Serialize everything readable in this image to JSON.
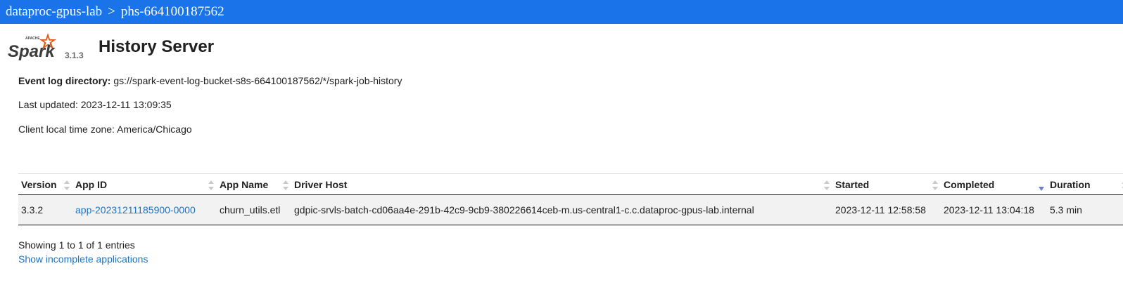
{
  "breadcrumb": {
    "project": "dataproc-gpus-lab",
    "separator": ">",
    "server": "phs-664100187562"
  },
  "header": {
    "logo_small": "APACHE",
    "logo_text": "Spark",
    "spark_version": "3.1.3",
    "title": "History Server"
  },
  "info": {
    "event_log_label": "Event log directory:",
    "event_log_value": "gs://spark-event-log-bucket-s8s-664100187562/*/spark-job-history",
    "last_updated": "Last updated: 2023-12-11 13:09:35",
    "timezone": "Client local time zone: America/Chicago"
  },
  "table": {
    "headers": [
      "Version",
      "App ID",
      "App Name",
      "Driver Host",
      "Started",
      "Completed",
      "Duration"
    ],
    "sorted_column": "Completed",
    "rows": [
      {
        "version": "3.3.2",
        "app_id": "app-20231211185900-0000",
        "app_name": "churn_utils.etl",
        "driver_host": "gdpic-srvls-batch-cd06aa4e-291b-42c9-9cb9-380226614ceb-m.us-central1-c.c.dataproc-gpus-lab.internal",
        "started": "2023-12-11 12:58:58",
        "completed": "2023-12-11 13:04:18",
        "duration": "5.3 min"
      }
    ]
  },
  "footer": {
    "showing": "Showing 1 to 1 of 1 entries",
    "incomplete_link": "Show incomplete applications"
  },
  "colors": {
    "topbar": "#1a73e8",
    "link": "#1a73c8",
    "row_bg": "#f2f2f2",
    "logo_orange": "#e25a1c"
  }
}
